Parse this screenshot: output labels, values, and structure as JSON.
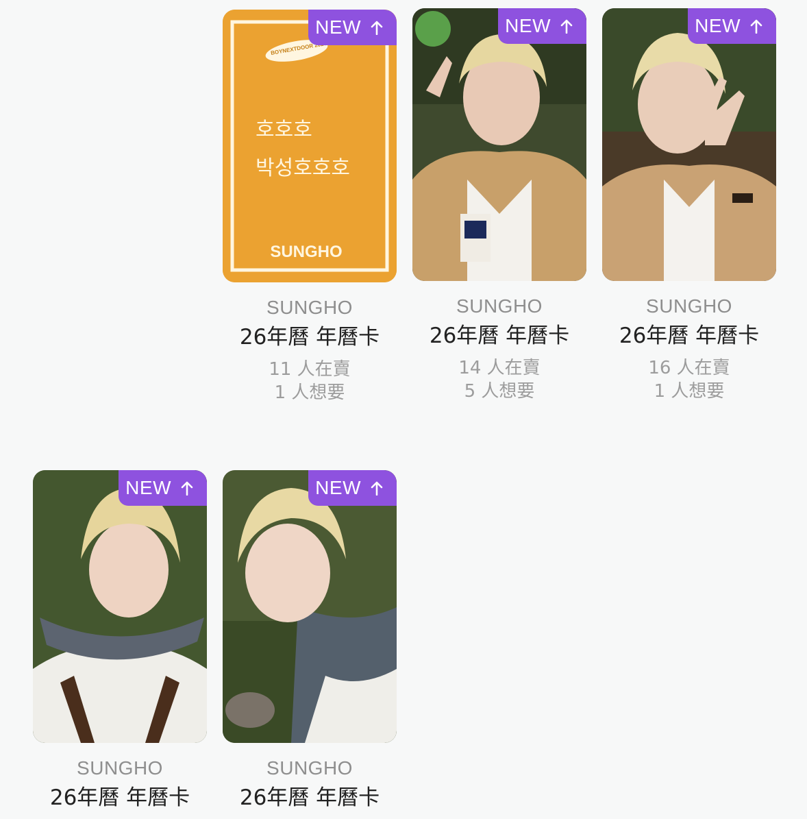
{
  "cards": [
    {
      "badge": "NEW",
      "artist": "SUNGHO",
      "title": "26年曆 年曆卡",
      "selling": "11 人在賣",
      "wanting": "1 人想要",
      "card_text": {
        "logo": "BOYNEXTDOOR 2026",
        "line1": "호호호",
        "line2": "박성호호호",
        "name": "SUNGHO"
      }
    },
    {
      "badge": "NEW",
      "artist": "SUNGHO",
      "title": "26年曆 年曆卡",
      "selling": "14 人在賣",
      "wanting": "5 人想要"
    },
    {
      "badge": "NEW",
      "artist": "SUNGHO",
      "title": "26年曆 年曆卡",
      "selling": "16 人在賣",
      "wanting": "1 人想要"
    },
    {
      "badge": "NEW",
      "artist": "SUNGHO",
      "title": "26年曆 年曆卡"
    },
    {
      "badge": "NEW",
      "artist": "SUNGHO",
      "title": "26年曆 年曆卡"
    }
  ],
  "colors": {
    "background": "#f7f8f8",
    "badge": "#8e52df",
    "artist": "#8e8e8e",
    "title": "#222222",
    "stat": "#9c9c9c",
    "orange_card": "#eba231"
  },
  "icons": {
    "badge_arrow": "arrow-up-icon"
  }
}
